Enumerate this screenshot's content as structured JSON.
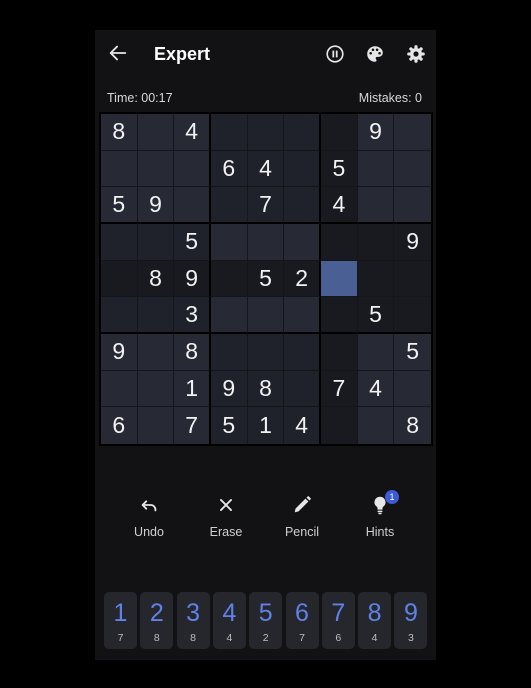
{
  "header": {
    "title": "Expert",
    "back_icon": "arrow-left-icon",
    "pause_icon": "pause-icon",
    "theme_icon": "palette-icon",
    "settings_icon": "gear-icon"
  },
  "status": {
    "time": "Time: 00:17",
    "mistakes": "Mistakes: 0"
  },
  "colors": {
    "background": "#121214",
    "cell": "#272a35",
    "cell_alt": "#1f222b",
    "cell_related": "#181a20",
    "cell_selected": "#4a5f94",
    "digit_blue": "#5f82e8",
    "badge": "#3d5bd6"
  },
  "board": {
    "selected": [
      4,
      6
    ],
    "grid": [
      [
        "8",
        "",
        "4",
        "",
        "",
        "",
        "",
        "9",
        ""
      ],
      [
        "",
        "",
        "",
        "6",
        "4",
        "",
        "5",
        "",
        ""
      ],
      [
        "5",
        "9",
        "",
        "",
        "7",
        "",
        "4",
        "",
        ""
      ],
      [
        "",
        "",
        "5",
        "",
        "",
        "",
        "",
        "",
        "9"
      ],
      [
        "",
        "8",
        "9",
        "",
        "5",
        "2",
        "",
        "",
        ""
      ],
      [
        "",
        "",
        "3",
        "",
        "",
        "",
        "",
        "5",
        ""
      ],
      [
        "9",
        "",
        "8",
        "",
        "",
        "",
        "",
        "",
        "5"
      ],
      [
        "",
        "",
        "1",
        "9",
        "8",
        "",
        "7",
        "4",
        ""
      ],
      [
        "6",
        "",
        "7",
        "5",
        "1",
        "4",
        "",
        "",
        "8"
      ]
    ]
  },
  "tools": [
    {
      "label": "Undo",
      "icon": "undo-icon"
    },
    {
      "label": "Erase",
      "icon": "close-icon"
    },
    {
      "label": "Pencil",
      "icon": "pencil-icon"
    },
    {
      "label": "Hints",
      "icon": "lightbulb-icon",
      "badge": "1"
    }
  ],
  "numpad": [
    {
      "digit": "1",
      "remaining": "7"
    },
    {
      "digit": "2",
      "remaining": "8"
    },
    {
      "digit": "3",
      "remaining": "8"
    },
    {
      "digit": "4",
      "remaining": "4"
    },
    {
      "digit": "5",
      "remaining": "2"
    },
    {
      "digit": "6",
      "remaining": "7"
    },
    {
      "digit": "7",
      "remaining": "6"
    },
    {
      "digit": "8",
      "remaining": "4"
    },
    {
      "digit": "9",
      "remaining": "3"
    }
  ]
}
